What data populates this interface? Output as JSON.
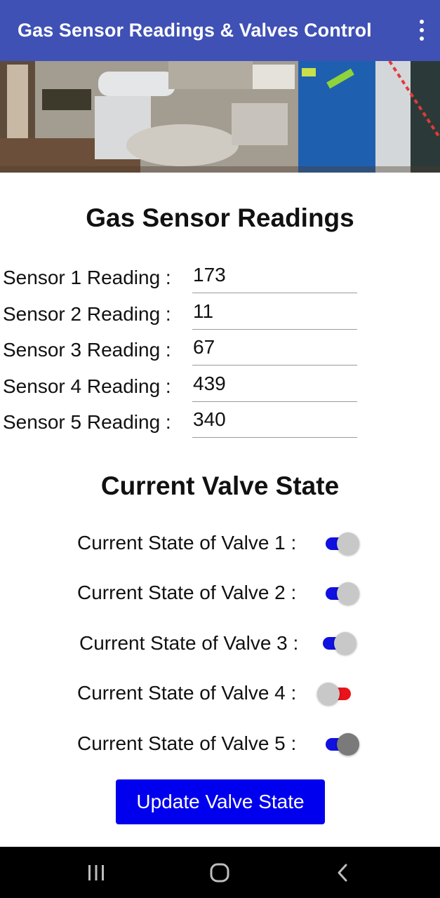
{
  "appbar": {
    "title": "Gas Sensor Readings & Valves Control",
    "menu_icon": "more-vert-icon"
  },
  "banner": {
    "icon": "industrial-gas-photo"
  },
  "readings": {
    "title": "Gas Sensor Readings",
    "sensors": [
      {
        "label": "Sensor 1 Reading :",
        "value": "173"
      },
      {
        "label": "Sensor 2 Reading :",
        "value": "11"
      },
      {
        "label": "Sensor 3 Reading :",
        "value": "67"
      },
      {
        "label": "Sensor 4 Reading :",
        "value": "439"
      },
      {
        "label": "Sensor 5 Reading :",
        "value": "340"
      }
    ]
  },
  "valves": {
    "title": "Current Valve State",
    "items": [
      {
        "label": "Current State of Valve 1 :",
        "on": true
      },
      {
        "label": "Current State of Valve 2 :",
        "on": true
      },
      {
        "label": "Current State of Valve 3 :",
        "on": true
      },
      {
        "label": "Current State of Valve 4 :",
        "on": false
      },
      {
        "label": "Current State of Valve 5 :",
        "on": true
      }
    ]
  },
  "update_button": {
    "label": "Update Valve State"
  },
  "navbar": {
    "recents_icon": "recents-icon",
    "home_icon": "home-icon",
    "back_icon": "back-icon"
  },
  "colors": {
    "appbar": "#3f51b5",
    "switch_on": "#1010e0",
    "switch_off": "#e8141a",
    "button": "#0000ee"
  }
}
